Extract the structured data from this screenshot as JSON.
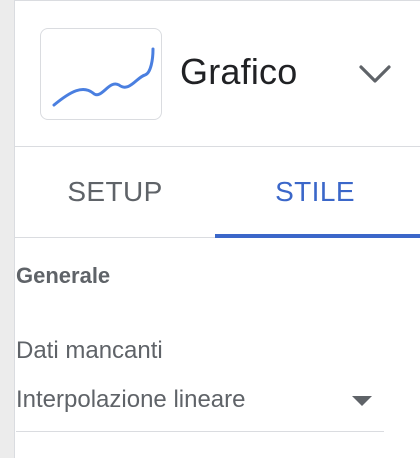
{
  "header": {
    "chart_type_title": "Grafico",
    "thumbnail_icon": "line-chart-icon",
    "expand_icon": "chevron-down-icon"
  },
  "tabs": [
    {
      "label": "SETUP",
      "active": false
    },
    {
      "label": "STILE",
      "active": true
    }
  ],
  "style": {
    "section_title": "Generale",
    "missing_data": {
      "label": "Dati mancanti",
      "value": "Interpolazione lineare"
    }
  },
  "colors": {
    "accent": "#3b67c9",
    "line": "#4a7fe0",
    "muted_text": "#5f6368",
    "divider": "#dadce0"
  }
}
